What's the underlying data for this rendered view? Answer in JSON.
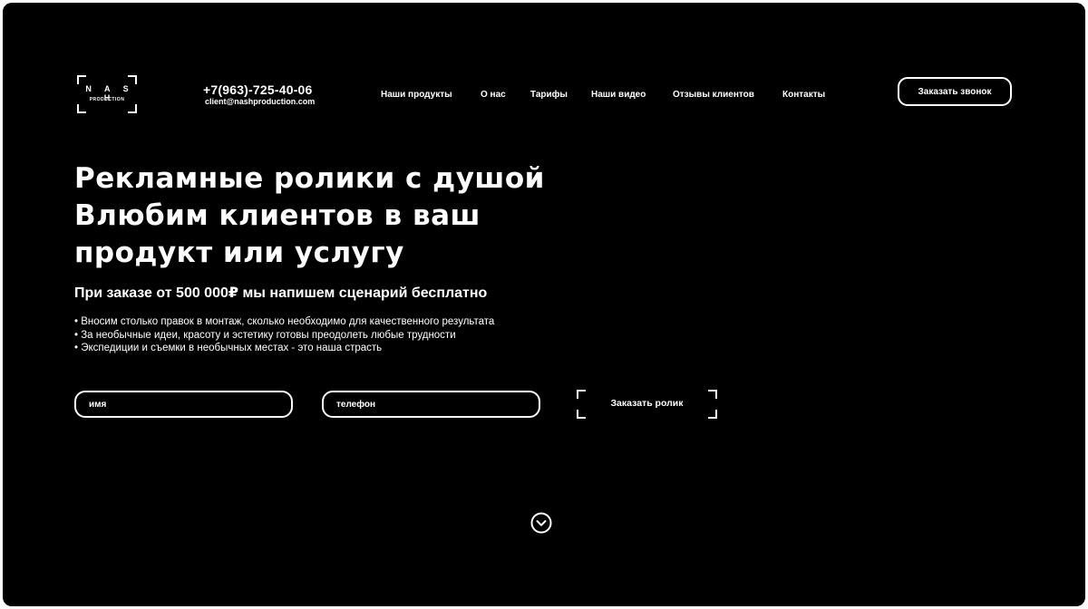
{
  "logo": {
    "brand": "N A S H",
    "sub": "PRODUCTION"
  },
  "contacts": {
    "phone": "+7(963)-725-40-06",
    "email": "client@nashproduction.com"
  },
  "nav": {
    "items": [
      "Наши продукты",
      "О нас",
      "Тарифы",
      "Наши видео",
      "Отзывы клиентов",
      "Контакты"
    ]
  },
  "header": {
    "call_button": "Заказать звонок"
  },
  "hero": {
    "title_lines": [
      "Рекламные ролики с душой",
      "Влюбим клиентов в ваш",
      "продукт или услугу"
    ],
    "subtitle": "При заказе от 500 000₽ мы напишем сценарий бесплатно",
    "bullets": [
      "• Вносим столько правок в монтаж, сколько необходимо для качественного результата",
      "• За необычные идеи, красоту и эстетику готовы преодолеть любые трудности",
      "• Экспедиции и съемки в необычных местах - это наша страсть"
    ]
  },
  "form": {
    "name_placeholder": "имя",
    "phone_placeholder": "телефон",
    "submit_label": "Заказать ролик"
  },
  "icons": {
    "scroll": "chevron-down-circle-icon"
  }
}
